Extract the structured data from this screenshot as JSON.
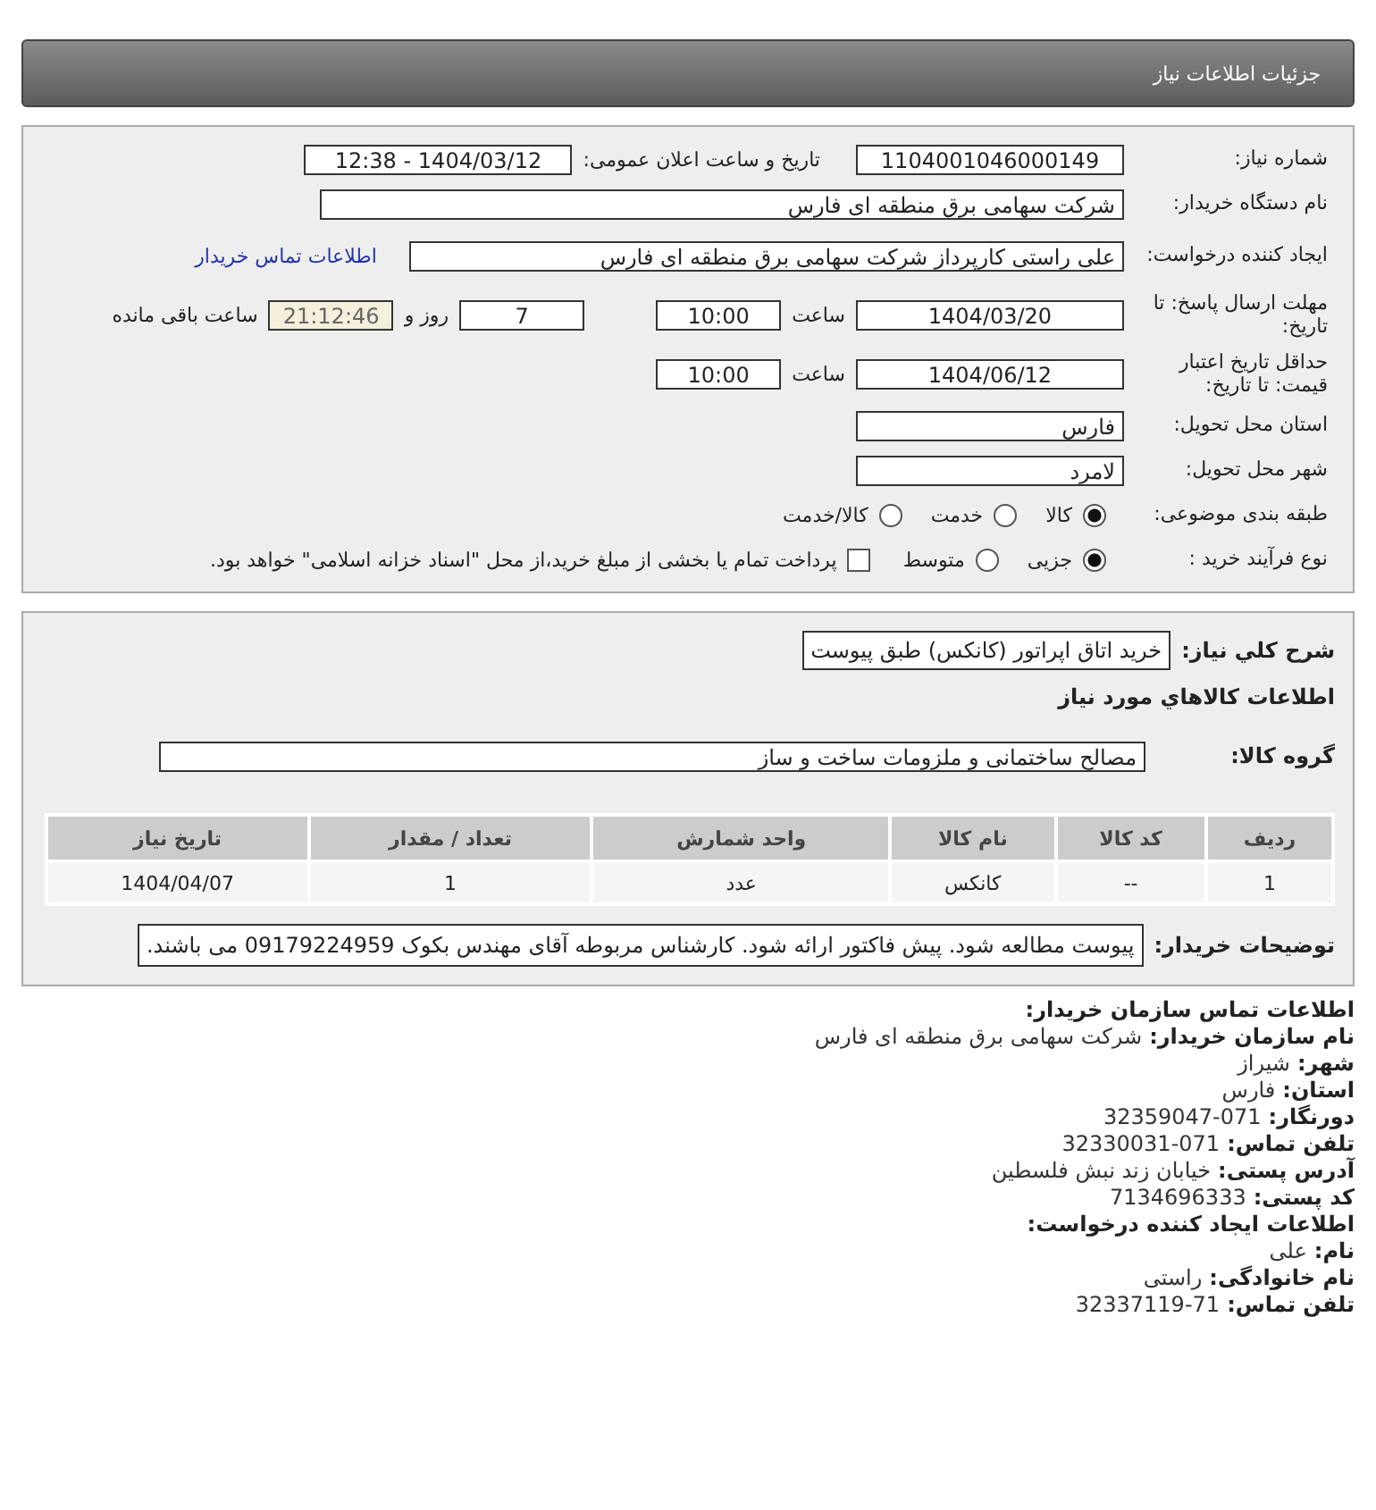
{
  "header": {
    "title": "جزئیات اطلاعات نیاز"
  },
  "form": {
    "need_number": {
      "label": "شماره نیاز:",
      "value": "1104001046000149"
    },
    "announce": {
      "label": "تاریخ و ساعت اعلان عمومی:",
      "value": "1404/03/12 - 12:38"
    },
    "buyer_org": {
      "label": "نام دستگاه خریدار:",
      "value": "شرکت سهامی برق منطقه ای فارس"
    },
    "requester": {
      "label": "ایجاد کننده درخواست:",
      "value": "علی راستی کارپرداز شرکت سهامی برق منطقه ای فارس",
      "link": "اطلاعات تماس خریدار"
    },
    "reply_deadline": {
      "label": "مهلت ارسال پاسخ: تا تاریخ:",
      "date": "1404/03/20",
      "time_label": "ساعت",
      "time": "10:00",
      "days": "7",
      "days_label": "روز و",
      "remaining": "21:12:46",
      "remaining_label": "ساعت باقی مانده"
    },
    "price_validity": {
      "label": "حداقل تاریخ اعتبار قیمت: تا تاریخ:",
      "date": "1404/06/12",
      "time_label": "ساعت",
      "time": "10:00"
    },
    "province": {
      "label": "استان محل تحویل:",
      "value": "فارس"
    },
    "city": {
      "label": "شهر محل تحویل:",
      "value": "لامرد"
    },
    "category": {
      "label": "طبقه بندی موضوعی:",
      "options": [
        {
          "label": "کالا",
          "selected": true
        },
        {
          "label": "خدمت",
          "selected": false
        },
        {
          "label": "کالا/خدمت",
          "selected": false
        }
      ]
    },
    "process": {
      "label": "نوع فرآیند خرید :",
      "options": [
        {
          "label": "جزیی",
          "selected": true
        },
        {
          "label": "متوسط",
          "selected": false
        }
      ],
      "payment": {
        "checked": false,
        "text": "پرداخت تمام یا بخشی از مبلغ خرید،از محل \"اسناد خزانه اسلامی\" خواهد بود."
      }
    }
  },
  "details": {
    "description": {
      "label": "شرح کلي نياز:",
      "value": "خرید اتاق اپراتور (کانکس) طبق پیوست"
    },
    "goods_title": "اطلاعات کالاهاي مورد نياز",
    "group": {
      "label": "گروه کالا:",
      "value": "مصالح ساختمانی و ملزومات ساخت  و ساز"
    },
    "table": {
      "columns": [
        "ردیف",
        "کد کالا",
        "نام کالا",
        "واحد شمارش",
        "تعداد / مقدار",
        "تاریخ نیاز"
      ],
      "rows": [
        [
          "1",
          "--",
          "کانکس",
          "عدد",
          "1",
          "1404/04/07"
        ]
      ]
    },
    "notes": {
      "label": "توضیحات خریدار:",
      "value": "پیوست مطالعه شود. پیش فاکتور ارائه شود. کارشناس مربوطه آقای مهندس بکوک 09179224959 می باشند."
    }
  },
  "contact": {
    "title": "اطلاعات تماس سازمان خریدار:",
    "lines": [
      {
        "label": "نام سازمان خریدار:",
        "value": "شرکت سهامی برق منطقه ای فارس"
      },
      {
        "label": "شهر:",
        "value": "شیراز"
      },
      {
        "label": "استان:",
        "value": "فارس"
      },
      {
        "label": "دورنگار:",
        "value": "071-32359047"
      },
      {
        "label": "تلفن تماس:",
        "value": "071-32330031"
      },
      {
        "label": "آدرس پستی:",
        "value": "خیابان زند نبش فلسطین"
      },
      {
        "label": "کد پستی:",
        "value": "7134696333"
      }
    ],
    "creator_title": "اطلاعات ایجاد کننده درخواست:",
    "creator_lines": [
      {
        "label": "نام:",
        "value": "علی"
      },
      {
        "label": "نام خانوادگی:",
        "value": "راستی"
      },
      {
        "label": "تلفن تماس:",
        "value": "71-32337119"
      }
    ]
  }
}
